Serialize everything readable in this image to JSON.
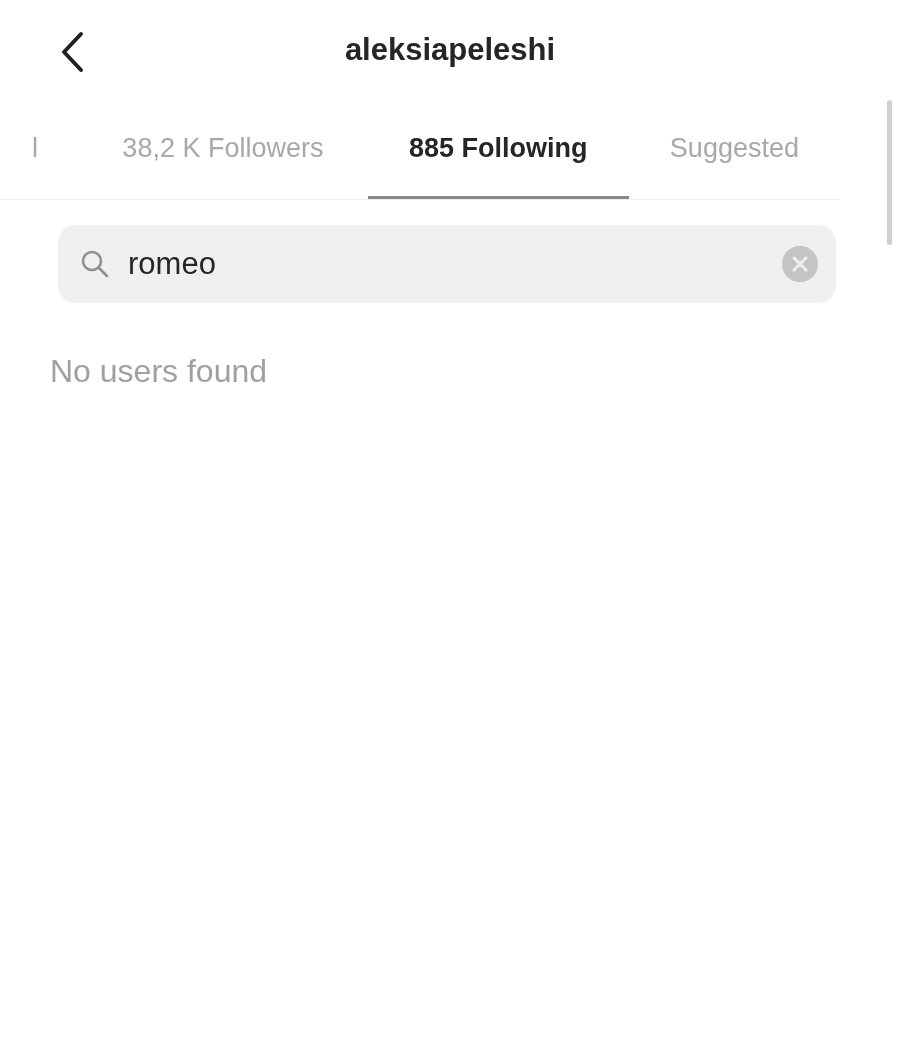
{
  "header": {
    "title": "aleksiapeleshi"
  },
  "tabs": [
    {
      "label": "l",
      "selected": false
    },
    {
      "label": "38,2 K Followers",
      "selected": false
    },
    {
      "label": "885 Following",
      "selected": true
    },
    {
      "label": "Suggested",
      "selected": false
    }
  ],
  "search": {
    "value": "romeo"
  },
  "message": "No users found"
}
